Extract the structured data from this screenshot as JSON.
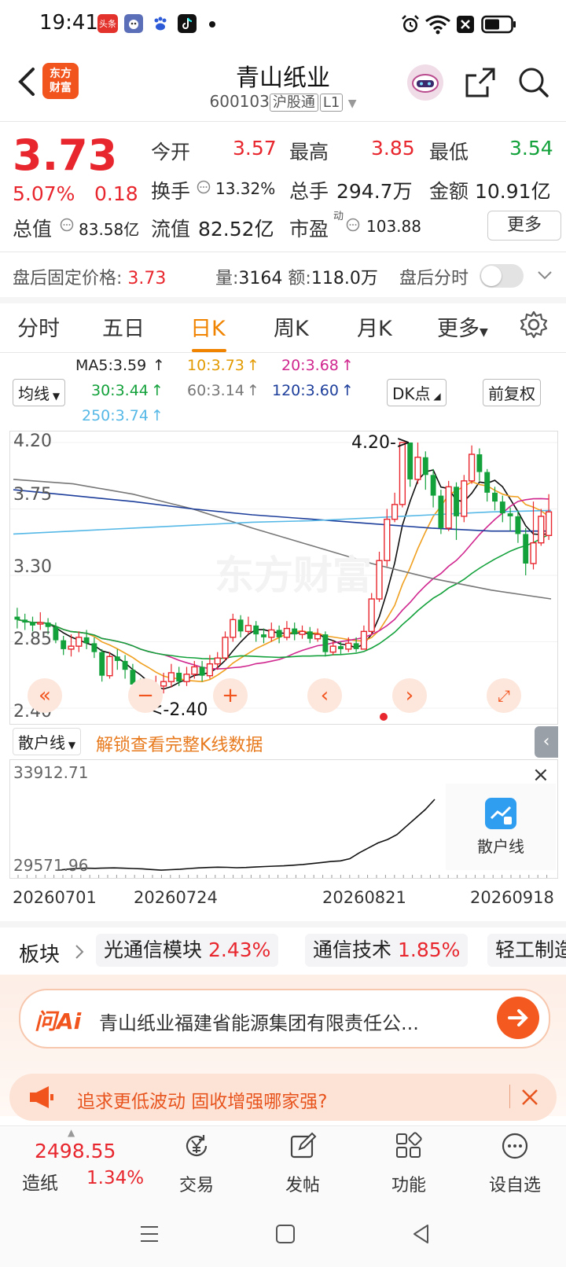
{
  "status": {
    "time": "19:41",
    "toutiao": "头条"
  },
  "header": {
    "logo_line1": "东方",
    "logo_line2": "财富",
    "title": "青山纸业",
    "code": "600103",
    "exchange_tag": "沪股通",
    "level_tag": "L1"
  },
  "quote": {
    "price": "3.73",
    "change_pct": "5.07%",
    "change": "0.18",
    "open_label": "今开",
    "open": "3.57",
    "high_label": "最高",
    "high": "3.85",
    "low_label": "最低",
    "low": "3.54",
    "turnover_label": "换手",
    "turnover": "13.32%",
    "volume_label": "总手",
    "volume": "294.7万",
    "amount_label": "金额",
    "amount": "10.91亿",
    "mktcap_label": "总值",
    "mktcap": "83.58亿",
    "float_label": "流值",
    "float": "82.52亿",
    "pe_label": "市盈",
    "pe_sup": "动",
    "pe": "103.88",
    "more": "更多"
  },
  "afterhours": {
    "label": "盘后固定价格:",
    "price": "3.73",
    "vol_label": "量:",
    "vol": "3164",
    "amt_label": "额:",
    "amt": "118.0万",
    "toggle_label": "盘后分时"
  },
  "tabs": [
    "分时",
    "五日",
    "日K",
    "周K",
    "月K",
    "更多"
  ],
  "ma": {
    "ma5": "MA5:3.59",
    "ma10": "10:3.73",
    "ma20": "20:3.68",
    "ma30": "30:3.44",
    "ma60": "60:3.14",
    "ma120": "120:3.60",
    "ma250": "250:3.74",
    "select": "均线",
    "dk": "DK点",
    "fq": "前复权"
  },
  "colors": {
    "up": "#e8262d",
    "down": "#13a13b",
    "accent": "#f08300",
    "brand": "#f2541e"
  },
  "chart_data": [
    {
      "type": "candlestick",
      "y_ticks": [
        "4.20",
        "3.75",
        "3.30",
        "2.85",
        "2.40"
      ],
      "ylim": [
        2.4,
        4.2
      ],
      "annotations": [
        "4.20->",
        "<-2.40"
      ],
      "watermark": "东方财富",
      "candles": [
        [
          3.02,
          3.0,
          3.08,
          2.94
        ],
        [
          3.0,
          2.98,
          3.04,
          2.93
        ],
        [
          2.98,
          2.96,
          3.02,
          2.92
        ],
        [
          2.97,
          2.98,
          3.05,
          2.93
        ],
        [
          2.98,
          2.95,
          3.01,
          2.9
        ],
        [
          2.95,
          2.86,
          2.98,
          2.84
        ],
        [
          2.86,
          2.8,
          2.89,
          2.76
        ],
        [
          2.8,
          2.82,
          2.9,
          2.75
        ],
        [
          2.82,
          2.88,
          2.92,
          2.78
        ],
        [
          2.88,
          2.84,
          2.93,
          2.8
        ],
        [
          2.84,
          2.78,
          2.88,
          2.74
        ],
        [
          2.78,
          2.62,
          2.8,
          2.58
        ],
        [
          2.62,
          2.75,
          2.78,
          2.6
        ],
        [
          2.75,
          2.72,
          2.8,
          2.66
        ],
        [
          2.72,
          2.66,
          2.76,
          2.6
        ],
        [
          2.66,
          2.56,
          2.7,
          2.52
        ],
        [
          2.56,
          2.44,
          2.6,
          2.4
        ],
        [
          2.44,
          2.52,
          2.58,
          2.42
        ],
        [
          2.52,
          2.55,
          2.62,
          2.46
        ],
        [
          2.55,
          2.58,
          2.64,
          2.5
        ],
        [
          2.58,
          2.64,
          2.7,
          2.54
        ],
        [
          2.64,
          2.58,
          2.68,
          2.55
        ],
        [
          2.58,
          2.63,
          2.68,
          2.55
        ],
        [
          2.63,
          2.68,
          2.72,
          2.6
        ],
        [
          2.68,
          2.62,
          2.72,
          2.58
        ],
        [
          2.62,
          2.7,
          2.76,
          2.6
        ],
        [
          2.7,
          2.74,
          2.78,
          2.66
        ],
        [
          2.74,
          2.88,
          2.92,
          2.72
        ],
        [
          2.88,
          3.0,
          3.04,
          2.85
        ],
        [
          3.0,
          2.92,
          3.03,
          2.88
        ],
        [
          2.92,
          2.96,
          3.02,
          2.9
        ],
        [
          2.96,
          2.9,
          2.99,
          2.85
        ],
        [
          2.9,
          2.88,
          2.94,
          2.84
        ],
        [
          2.88,
          2.93,
          2.98,
          2.85
        ],
        [
          2.93,
          2.88,
          2.96,
          2.84
        ],
        [
          2.88,
          2.94,
          2.99,
          2.86
        ],
        [
          2.94,
          2.9,
          2.98,
          2.86
        ],
        [
          2.9,
          2.92,
          2.96,
          2.87
        ],
        [
          2.92,
          2.87,
          2.95,
          2.84
        ],
        [
          2.87,
          2.9,
          2.94,
          2.85
        ],
        [
          2.9,
          2.78,
          2.92,
          2.75
        ],
        [
          2.78,
          2.82,
          2.86,
          2.76
        ],
        [
          2.82,
          2.8,
          2.85,
          2.76
        ],
        [
          2.8,
          2.84,
          2.88,
          2.78
        ],
        [
          2.84,
          2.8,
          2.88,
          2.78
        ],
        [
          2.8,
          2.92,
          2.96,
          2.8
        ],
        [
          2.92,
          3.14,
          3.18,
          2.9
        ],
        [
          3.14,
          3.4,
          3.46,
          3.12
        ],
        [
          3.4,
          3.68,
          3.75,
          3.36
        ],
        [
          3.68,
          3.78,
          3.86,
          3.66
        ],
        [
          3.78,
          4.2,
          4.2,
          3.76
        ],
        [
          4.2,
          3.95,
          4.2,
          3.9
        ],
        [
          3.95,
          4.1,
          4.2,
          3.92
        ],
        [
          4.1,
          3.98,
          4.14,
          3.88
        ],
        [
          3.98,
          3.84,
          4.02,
          3.76
        ],
        [
          3.84,
          3.62,
          3.88,
          3.58
        ],
        [
          3.62,
          3.9,
          3.94,
          3.6
        ],
        [
          3.9,
          3.7,
          3.93,
          3.54
        ],
        [
          3.7,
          3.94,
          3.98,
          3.66
        ],
        [
          3.94,
          4.12,
          4.18,
          3.92
        ],
        [
          4.12,
          4.0,
          4.16,
          3.94
        ],
        [
          4.0,
          3.86,
          4.02,
          3.8
        ],
        [
          3.86,
          3.8,
          3.9,
          3.74
        ],
        [
          3.8,
          3.72,
          3.84,
          3.66
        ],
        [
          3.72,
          3.7,
          3.76,
          3.6
        ],
        [
          3.7,
          3.58,
          3.74,
          3.52
        ],
        [
          3.58,
          3.38,
          3.62,
          3.3
        ],
        [
          3.38,
          3.52,
          3.8,
          3.34
        ],
        [
          3.52,
          3.7,
          3.75,
          3.5
        ],
        [
          3.57,
          3.73,
          3.85,
          3.54
        ]
      ]
    },
    {
      "type": "line",
      "series_label": "散户线",
      "unlock_text": "解锁查看完整K线数据",
      "y_ticks": [
        "33912.71",
        "29571.96"
      ],
      "ylim": [
        29571.96,
        33912.71
      ],
      "x_labels": [
        "20260701",
        "20260724",
        "20260821",
        "20260918"
      ],
      "values": [
        29650,
        29720,
        29760,
        29780,
        29770,
        29790,
        29800,
        29780,
        29760,
        29740,
        29700,
        29660,
        29690,
        29720,
        29760,
        29800,
        29820,
        29840,
        29830,
        29810,
        29820,
        29850,
        29880,
        29900,
        29920,
        29960,
        30000,
        30060,
        30120,
        30180,
        30220,
        30350,
        30700,
        31000,
        31300,
        31500,
        31800,
        32300,
        32800,
        33300,
        33912.71
      ]
    }
  ],
  "subchart": {
    "close": "×",
    "retail_label": "散户线"
  },
  "sectors": {
    "label": "板块",
    "items": [
      {
        "name": "光通信模块",
        "pct": "2.43%"
      },
      {
        "name": "通信技术",
        "pct": "1.85%"
      },
      {
        "name": "轻工制造",
        "pct": ""
      }
    ]
  },
  "ai": {
    "logo": "问Ai",
    "text": "青山纸业福建省能源集团有限责任公..."
  },
  "banner": {
    "text": "追求更低波动 固收增强哪家强?"
  },
  "bottom": {
    "index_value": "2498.55",
    "index_name": "造纸",
    "index_pct": "1.34%",
    "nav": [
      "交易",
      "发帖",
      "功能",
      "设自选"
    ]
  }
}
